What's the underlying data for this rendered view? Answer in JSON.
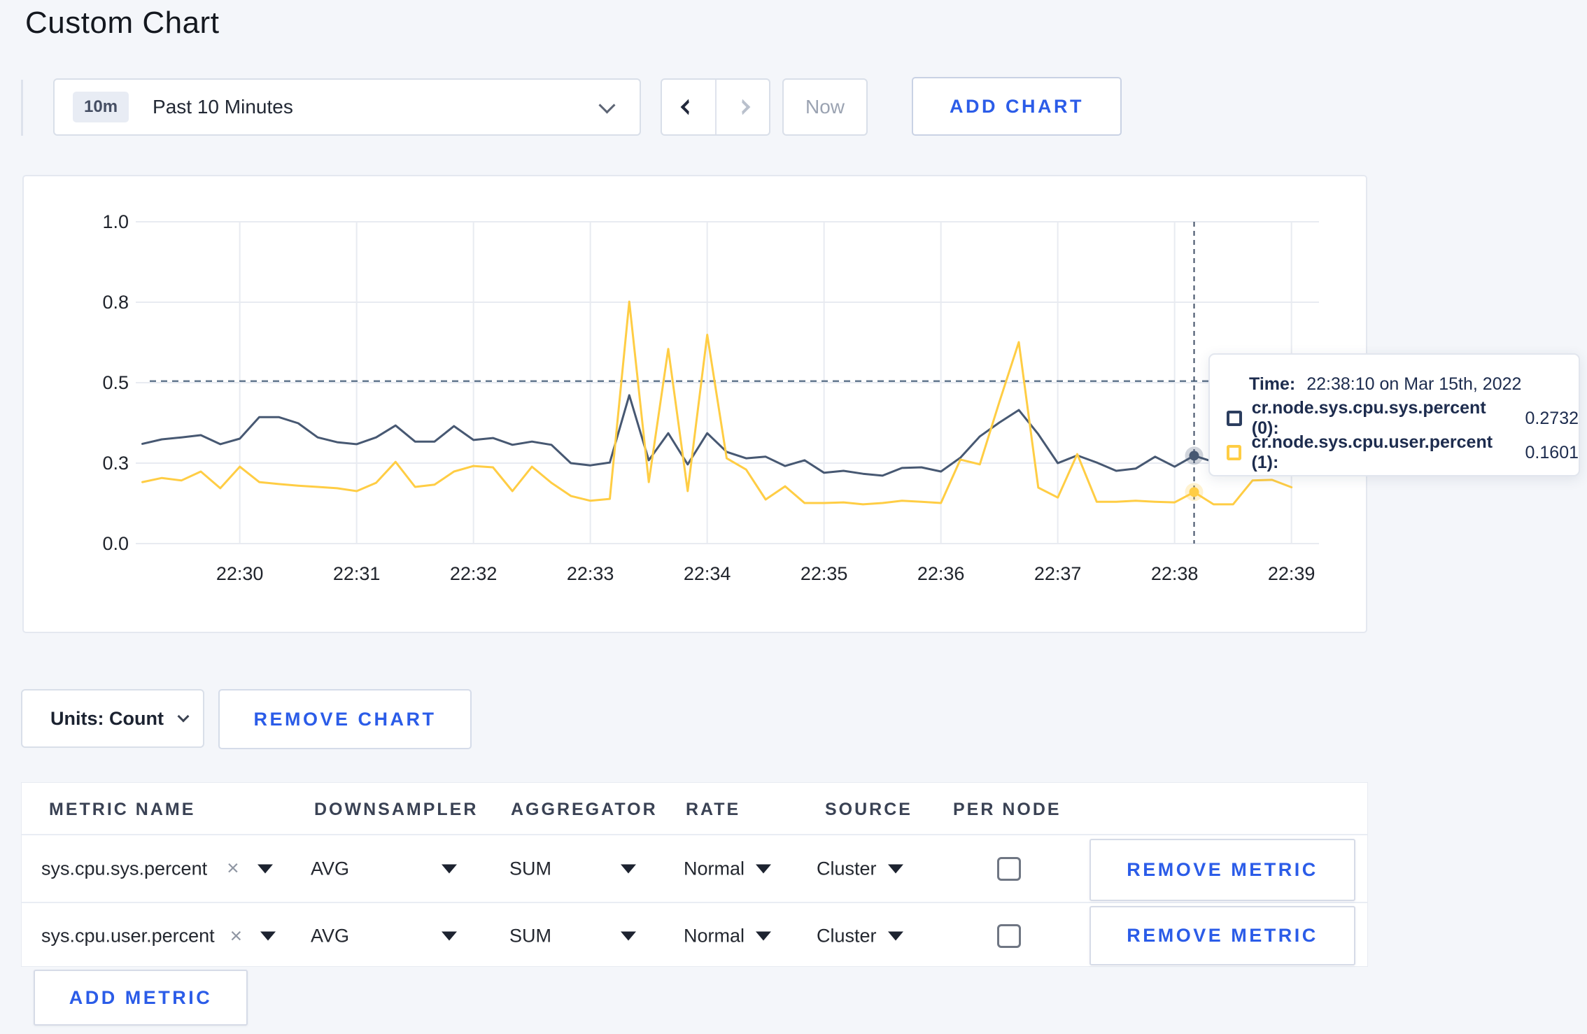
{
  "page": {
    "title": "Custom Chart"
  },
  "toolbar": {
    "time_range_badge": "10m",
    "time_range_label": "Past 10 Minutes",
    "now_label": "Now",
    "add_chart_label": "ADD CHART"
  },
  "tooltip": {
    "time_label": "Time:",
    "time_value": "22:38:10 on Mar 15th, 2022",
    "series": [
      {
        "name": "cr.node.sys.cpu.sys.percent (0):",
        "value": "0.2732",
        "color": "#2c3e5f"
      },
      {
        "name": "cr.node.sys.cpu.user.percent (1):",
        "value": "0.1601",
        "color": "#ffcd44"
      }
    ]
  },
  "chart_controls": {
    "units_label": "Units: Count",
    "remove_chart_label": "REMOVE CHART"
  },
  "metrics_table": {
    "headers": [
      "METRIC NAME",
      "DOWNSAMPLER",
      "AGGREGATOR",
      "RATE",
      "SOURCE",
      "PER NODE"
    ],
    "rows": [
      {
        "metric": "sys.cpu.sys.percent",
        "downsampler": "AVG",
        "aggregator": "SUM",
        "rate": "Normal",
        "source": "Cluster",
        "per_node_checked": false,
        "remove_label": "REMOVE METRIC"
      },
      {
        "metric": "sys.cpu.user.percent",
        "downsampler": "AVG",
        "aggregator": "SUM",
        "rate": "Normal",
        "source": "Cluster",
        "per_node_checked": false,
        "remove_label": "REMOVE METRIC"
      }
    ],
    "add_metric_label": "ADD METRIC",
    "clear_icon": "×"
  },
  "chart_data": {
    "type": "line",
    "title": "",
    "xlabel": "",
    "ylabel": "",
    "grid": true,
    "ylim": [
      0,
      1
    ],
    "x_range": [
      "22:29:10",
      "22:39:20"
    ],
    "y_ticks": [
      {
        "label": "0.0",
        "value": 0
      },
      {
        "label": "0.3",
        "value": 0.25
      },
      {
        "label": "0.5",
        "value": 0.5
      },
      {
        "label": "0.8",
        "value": 0.75
      },
      {
        "label": "1.0",
        "value": 1
      }
    ],
    "x_ticks": [
      {
        "label": "22:30",
        "time": "22:30:00"
      },
      {
        "label": "22:31",
        "time": "22:31:00"
      },
      {
        "label": "22:32",
        "time": "22:32:00"
      },
      {
        "label": "22:33",
        "time": "22:33:00"
      },
      {
        "label": "22:34",
        "time": "22:34:00"
      },
      {
        "label": "22:35",
        "time": "22:35:00"
      },
      {
        "label": "22:36",
        "time": "22:36:00"
      },
      {
        "label": "22:37",
        "time": "22:37:00"
      },
      {
        "label": "22:38",
        "time": "22:38:00"
      },
      {
        "label": "22:39",
        "time": "22:39:00"
      }
    ],
    "guide_line_value": 0.505,
    "crosshair_time": "22:38:10",
    "hover_points": [
      {
        "series": "cr.node.sys.cpu.sys.percent",
        "time": "22:38:10",
        "value": 0.2732
      },
      {
        "series": "cr.node.sys.cpu.user.percent",
        "time": "22:38:10",
        "value": 0.1601
      }
    ],
    "series": [
      {
        "name": "cr.node.sys.cpu.sys.percent",
        "color": "#475872",
        "points": [
          [
            "22:29:10",
            0.31
          ],
          [
            "22:29:20",
            0.324
          ],
          [
            "22:29:30",
            0.33
          ],
          [
            "22:29:40",
            0.337
          ],
          [
            "22:29:50",
            0.309
          ],
          [
            "22:30:00",
            0.326
          ],
          [
            "22:30:10",
            0.393
          ],
          [
            "22:30:20",
            0.393
          ],
          [
            "22:30:30",
            0.374
          ],
          [
            "22:30:40",
            0.33
          ],
          [
            "22:30:50",
            0.315
          ],
          [
            "22:31:00",
            0.309
          ],
          [
            "22:31:10",
            0.33
          ],
          [
            "22:31:20",
            0.367
          ],
          [
            "22:31:30",
            0.317
          ],
          [
            "22:31:40",
            0.317
          ],
          [
            "22:31:50",
            0.365
          ],
          [
            "22:32:00",
            0.322
          ],
          [
            "22:32:10",
            0.328
          ],
          [
            "22:32:20",
            0.307
          ],
          [
            "22:32:30",
            0.317
          ],
          [
            "22:32:40",
            0.307
          ],
          [
            "22:32:50",
            0.25
          ],
          [
            "22:33:00",
            0.243
          ],
          [
            "22:33:10",
            0.252
          ],
          [
            "22:33:20",
            0.461
          ],
          [
            "22:33:30",
            0.259
          ],
          [
            "22:33:40",
            0.343
          ],
          [
            "22:33:50",
            0.246
          ],
          [
            "22:34:00",
            0.343
          ],
          [
            "22:34:10",
            0.285
          ],
          [
            "22:34:20",
            0.265
          ],
          [
            "22:34:30",
            0.27
          ],
          [
            "22:34:40",
            0.241
          ],
          [
            "22:34:50",
            0.259
          ],
          [
            "22:35:00",
            0.22
          ],
          [
            "22:35:10",
            0.226
          ],
          [
            "22:35:20",
            0.217
          ],
          [
            "22:35:30",
            0.211
          ],
          [
            "22:35:40",
            0.235
          ],
          [
            "22:35:50",
            0.237
          ],
          [
            "22:36:00",
            0.224
          ],
          [
            "22:36:10",
            0.267
          ],
          [
            "22:36:20",
            0.333
          ],
          [
            "22:36:30",
            0.376
          ],
          [
            "22:36:40",
            0.415
          ],
          [
            "22:36:50",
            0.34
          ],
          [
            "22:37:00",
            0.25
          ],
          [
            "22:37:10",
            0.274
          ],
          [
            "22:37:20",
            0.252
          ],
          [
            "22:37:30",
            0.226
          ],
          [
            "22:37:40",
            0.233
          ],
          [
            "22:37:50",
            0.27
          ],
          [
            "22:38:00",
            0.239
          ],
          [
            "22:38:10",
            0.2732
          ],
          [
            "22:38:20",
            0.254
          ]
        ]
      },
      {
        "name": "cr.node.sys.cpu.user.percent",
        "color": "#ffcd44",
        "points": [
          [
            "22:29:10",
            0.191
          ],
          [
            "22:29:20",
            0.204
          ],
          [
            "22:29:30",
            0.196
          ],
          [
            "22:29:40",
            0.224
          ],
          [
            "22:29:50",
            0.172
          ],
          [
            "22:30:00",
            0.239
          ],
          [
            "22:30:10",
            0.191
          ],
          [
            "22:30:20",
            0.185
          ],
          [
            "22:30:30",
            0.18
          ],
          [
            "22:30:40",
            0.176
          ],
          [
            "22:30:50",
            0.172
          ],
          [
            "22:31:00",
            0.163
          ],
          [
            "22:31:10",
            0.189
          ],
          [
            "22:31:20",
            0.254
          ],
          [
            "22:31:30",
            0.176
          ],
          [
            "22:31:40",
            0.183
          ],
          [
            "22:31:50",
            0.224
          ],
          [
            "22:32:00",
            0.241
          ],
          [
            "22:32:10",
            0.237
          ],
          [
            "22:32:20",
            0.163
          ],
          [
            "22:32:30",
            0.239
          ],
          [
            "22:32:40",
            0.189
          ],
          [
            "22:32:50",
            0.148
          ],
          [
            "22:33:00",
            0.133
          ],
          [
            "22:33:10",
            0.139
          ],
          [
            "22:33:20",
            0.752
          ],
          [
            "22:33:30",
            0.191
          ],
          [
            "22:33:40",
            0.605
          ],
          [
            "22:33:50",
            0.163
          ],
          [
            "22:34:00",
            0.649
          ],
          [
            "22:34:10",
            0.265
          ],
          [
            "22:34:20",
            0.23
          ],
          [
            "22:34:30",
            0.137
          ],
          [
            "22:34:40",
            0.178
          ],
          [
            "22:34:50",
            0.126
          ],
          [
            "22:35:00",
            0.126
          ],
          [
            "22:35:10",
            0.128
          ],
          [
            "22:35:20",
            0.122
          ],
          [
            "22:35:30",
            0.126
          ],
          [
            "22:35:40",
            0.133
          ],
          [
            "22:35:50",
            0.13
          ],
          [
            "22:36:00",
            0.126
          ],
          [
            "22:36:10",
            0.261
          ],
          [
            "22:36:20",
            0.246
          ],
          [
            "22:36:30",
            0.44
          ],
          [
            "22:36:40",
            0.626
          ],
          [
            "22:36:50",
            0.174
          ],
          [
            "22:37:00",
            0.143
          ],
          [
            "22:37:10",
            0.278
          ],
          [
            "22:37:20",
            0.13
          ],
          [
            "22:37:30",
            0.13
          ],
          [
            "22:37:40",
            0.133
          ],
          [
            "22:37:50",
            0.13
          ],
          [
            "22:38:00",
            0.128
          ],
          [
            "22:38:10",
            0.1601
          ],
          [
            "22:38:20",
            0.122
          ],
          [
            "22:38:30",
            0.122
          ],
          [
            "22:38:40",
            0.196
          ],
          [
            "22:38:50",
            0.198
          ],
          [
            "22:39:00",
            0.175
          ]
        ]
      }
    ]
  }
}
